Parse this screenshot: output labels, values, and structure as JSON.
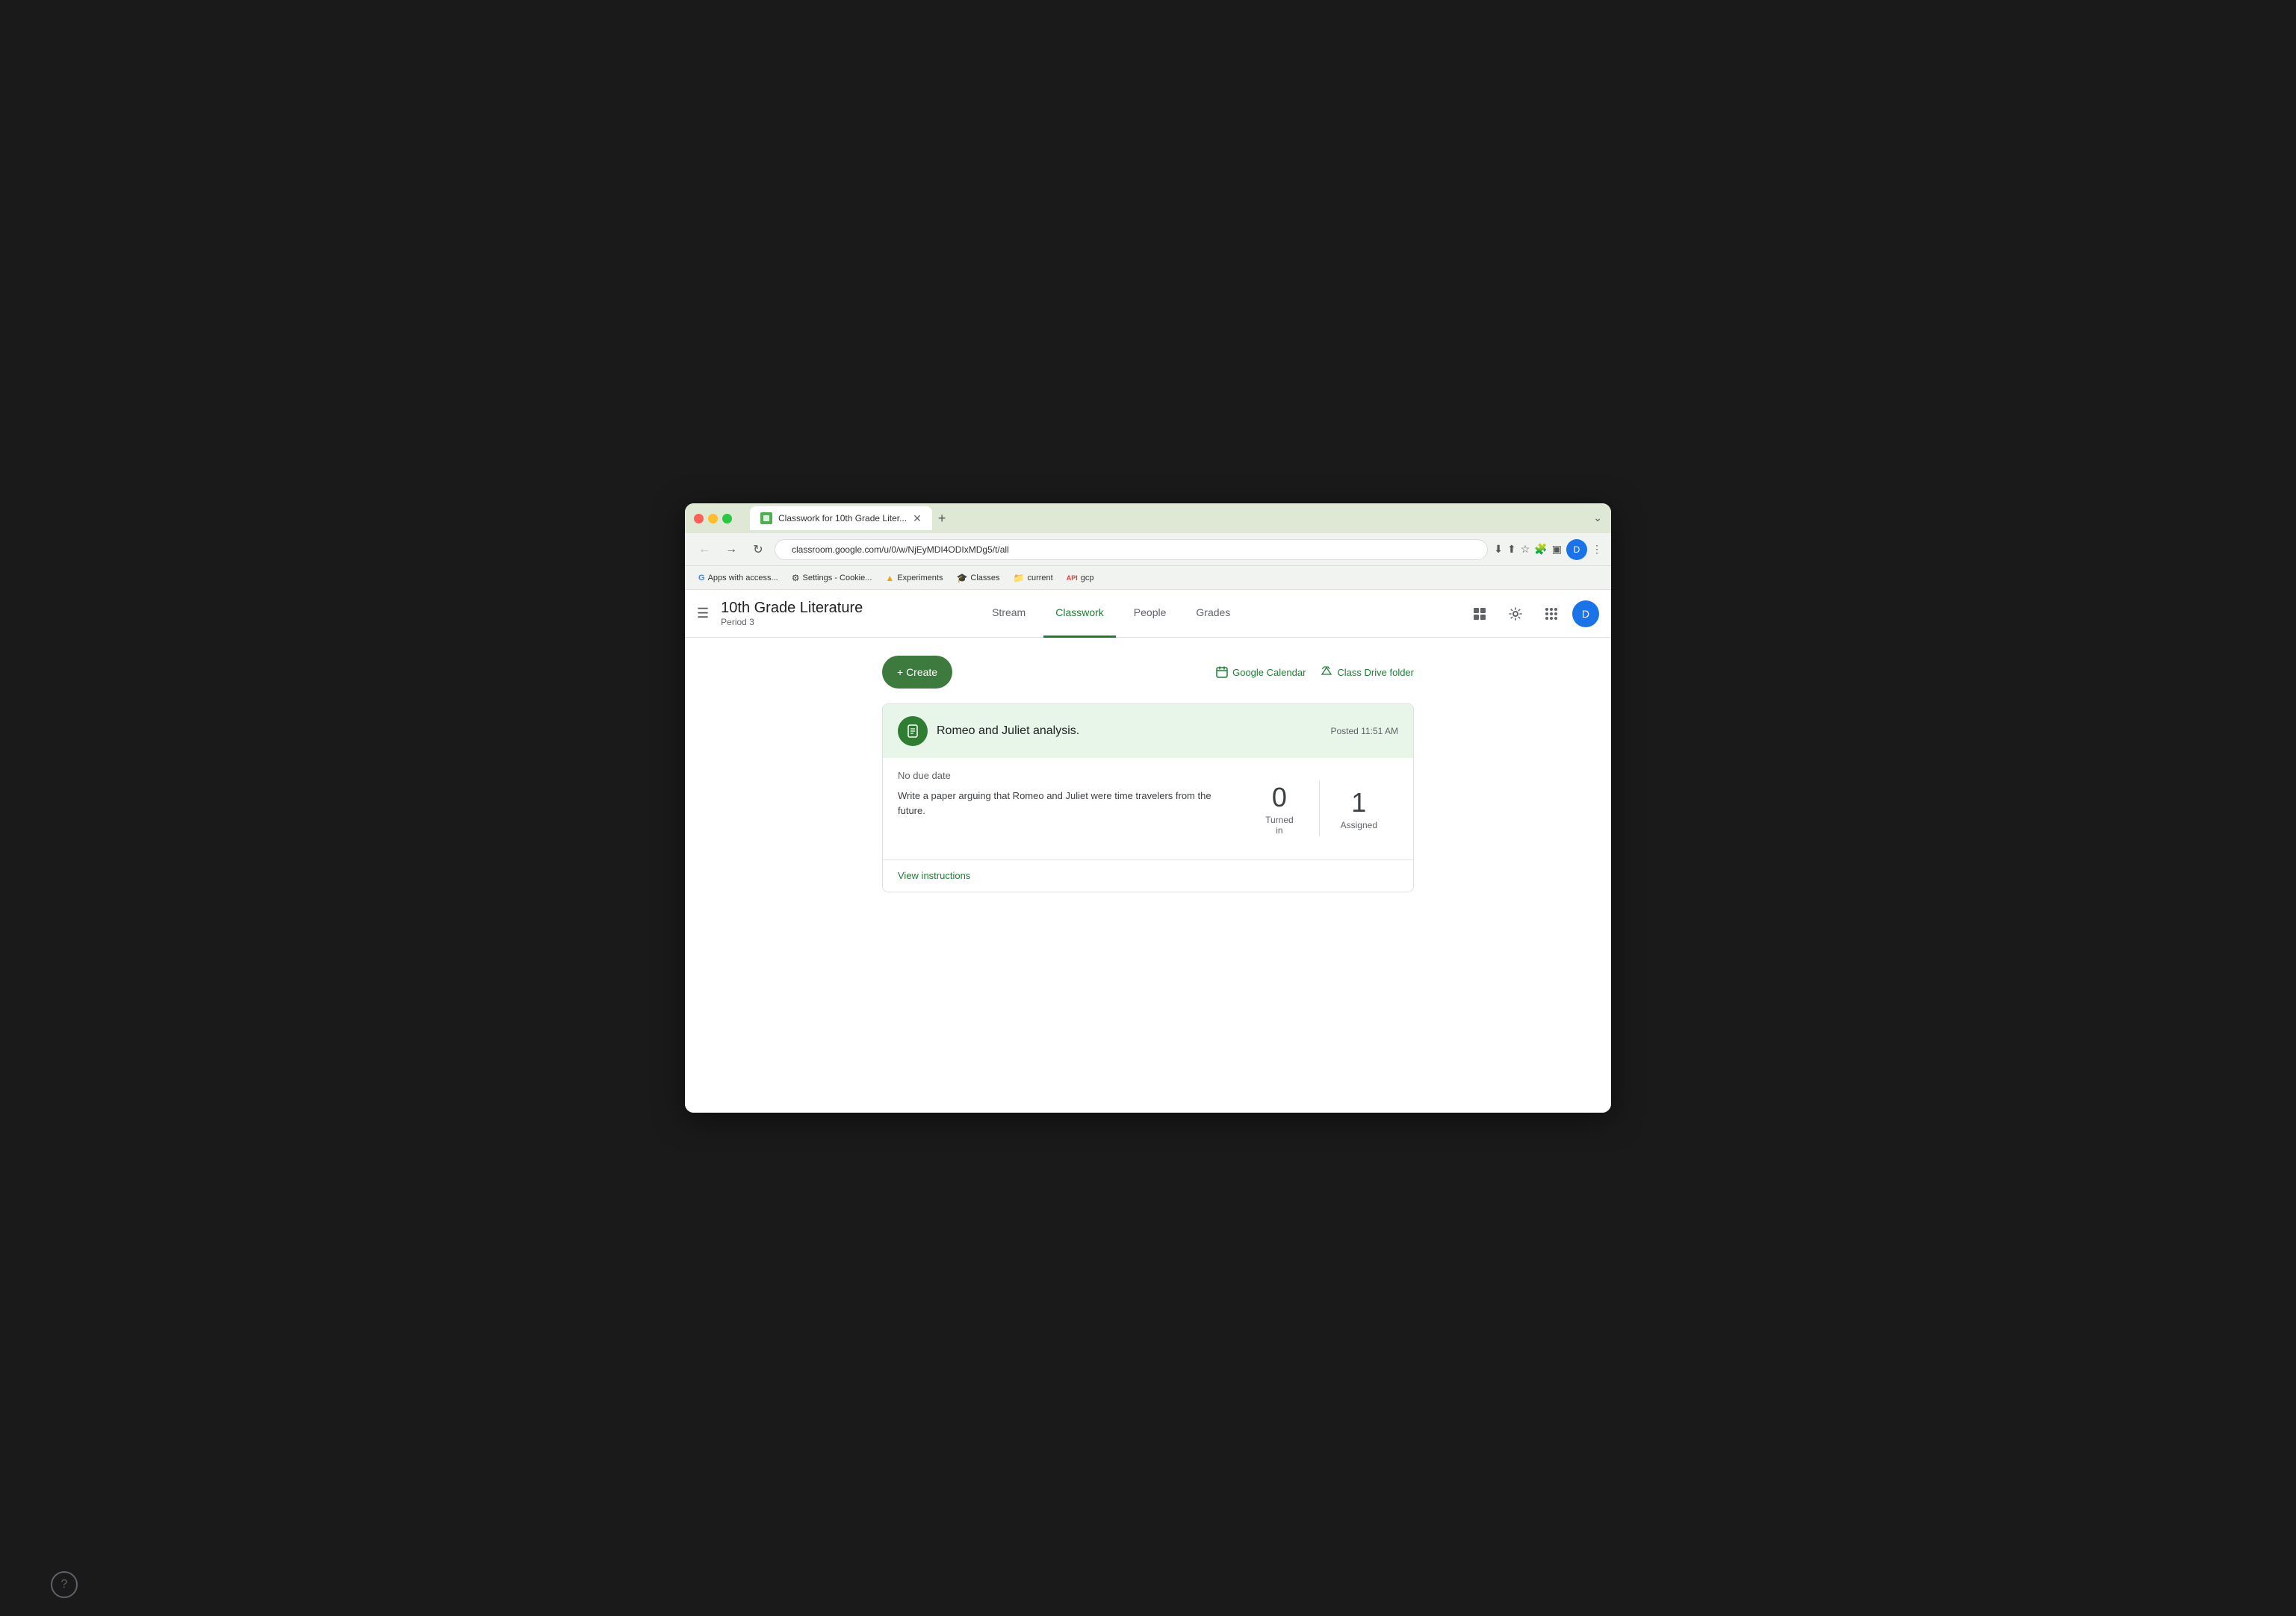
{
  "browser": {
    "tab_title": "Classwork for 10th Grade Liter...",
    "url": "classroom.google.com/u/0/w/NjEyMDI4ODIxMDg5/t/all",
    "new_tab_label": "+",
    "bookmarks": [
      {
        "icon": "G",
        "label": "Apps with access..."
      },
      {
        "icon": "⚙",
        "label": "Settings - Cookie..."
      },
      {
        "icon": "▲",
        "label": "Experiments"
      },
      {
        "icon": "🎓",
        "label": "Classes"
      },
      {
        "icon": "📁",
        "label": "current"
      },
      {
        "icon": "API",
        "label": "gcp"
      }
    ]
  },
  "app": {
    "class_name": "10th Grade Literature",
    "class_period": "Period 3",
    "nav_tabs": [
      {
        "label": "Stream",
        "active": false
      },
      {
        "label": "Classwork",
        "active": true
      },
      {
        "label": "People",
        "active": false
      },
      {
        "label": "Grades",
        "active": false
      }
    ],
    "toolbar": {
      "create_label": "+ Create",
      "google_calendar_label": "Google Calendar",
      "class_drive_folder_label": "Class Drive folder"
    },
    "assignment": {
      "title": "Romeo and Juliet analysis.",
      "posted": "Posted 11:51 AM",
      "no_due_date": "No due date",
      "description": "Write a paper arguing that Romeo and Juliet were time travelers from the future.",
      "turned_in_count": "0",
      "turned_in_label": "Turned in",
      "assigned_count": "1",
      "assigned_label": "Assigned",
      "view_instructions_label": "View instructions"
    },
    "help_button_label": "?"
  }
}
